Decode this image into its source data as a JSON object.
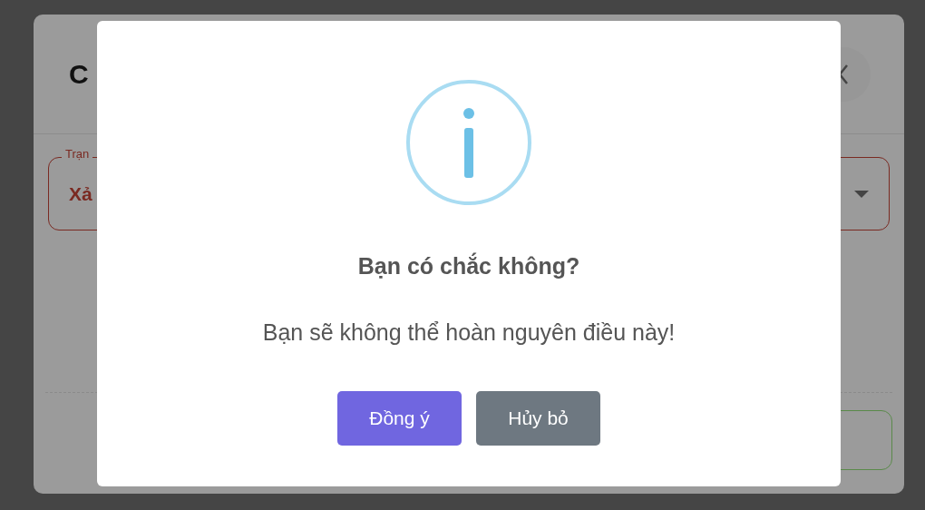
{
  "background_dialog": {
    "title": "C",
    "field": {
      "label": "Trạn",
      "value": "Xả"
    }
  },
  "alert": {
    "kind": "info",
    "title": "Bạn có chắc không?",
    "text": "Bạn sẽ không thể hoàn nguyên điều này!",
    "confirm": "Đồng ý",
    "cancel": "Hủy bỏ"
  }
}
